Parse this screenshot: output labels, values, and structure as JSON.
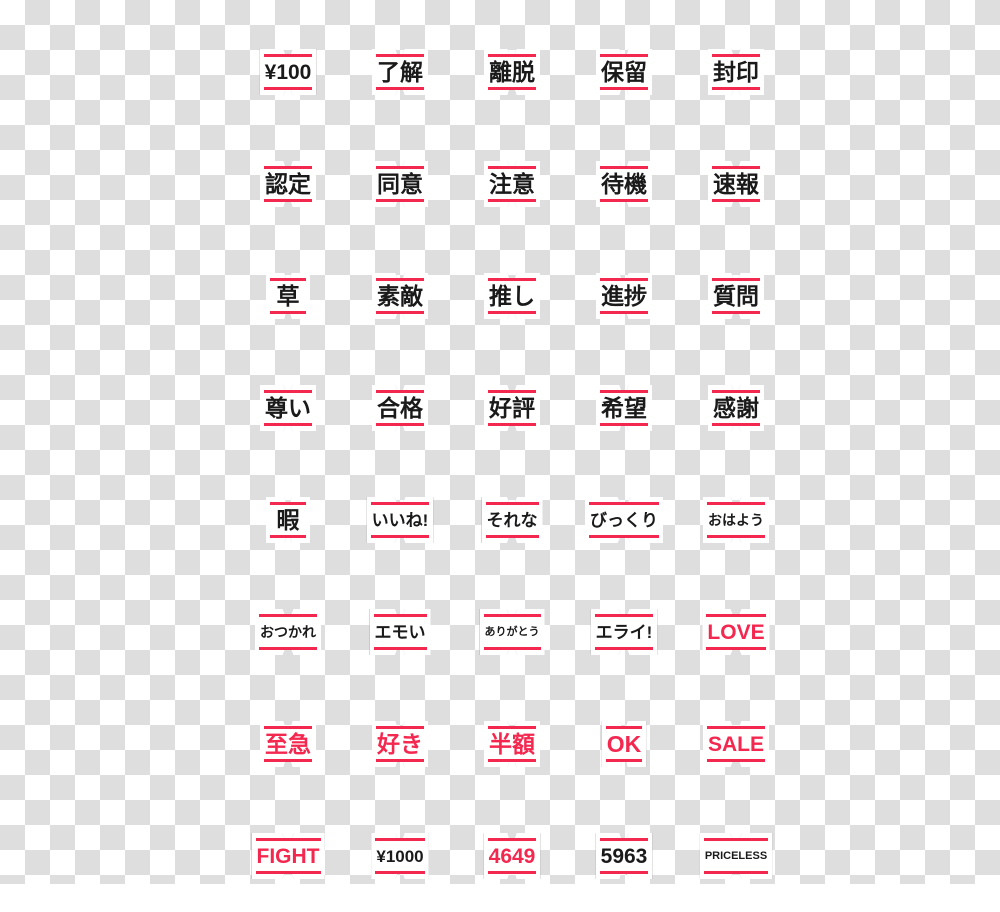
{
  "sheet": {
    "title": "Price Tag Sticker Sheet",
    "background": "transparent-checkerboard",
    "colors": {
      "accent_red": "#f4274f",
      "text_black": "#1a1a1a",
      "sticker_face": "#ffffff",
      "sticker_border": "#b4b4b4",
      "checker_gray": "#dedede",
      "checker_white": "#ffffff"
    },
    "grid": {
      "columns": 5,
      "rows": 8,
      "total": 40
    }
  },
  "stickers": [
    {
      "text": "¥100",
      "color": "black",
      "size": "lg",
      "script": "latin"
    },
    {
      "text": "了解",
      "color": "black",
      "size": "xl",
      "script": "cjk"
    },
    {
      "text": "離脱",
      "color": "black",
      "size": "xl",
      "script": "cjk"
    },
    {
      "text": "保留",
      "color": "black",
      "size": "xl",
      "script": "cjk"
    },
    {
      "text": "封印",
      "color": "black",
      "size": "xl",
      "script": "cjk"
    },
    {
      "text": "認定",
      "color": "black",
      "size": "xl",
      "script": "cjk"
    },
    {
      "text": "同意",
      "color": "black",
      "size": "xl",
      "script": "cjk"
    },
    {
      "text": "注意",
      "color": "black",
      "size": "xl",
      "script": "cjk"
    },
    {
      "text": "待機",
      "color": "black",
      "size": "xl",
      "script": "cjk"
    },
    {
      "text": "速報",
      "color": "black",
      "size": "xl",
      "script": "cjk"
    },
    {
      "text": "草",
      "color": "black",
      "size": "xl",
      "script": "cjk"
    },
    {
      "text": "素敵",
      "color": "black",
      "size": "xl",
      "script": "cjk"
    },
    {
      "text": "推し",
      "color": "black",
      "size": "xl",
      "script": "cjk"
    },
    {
      "text": "進捗",
      "color": "black",
      "size": "xl",
      "script": "cjk"
    },
    {
      "text": "質問",
      "color": "black",
      "size": "xl",
      "script": "cjk"
    },
    {
      "text": "尊い",
      "color": "black",
      "size": "xl",
      "script": "cjk"
    },
    {
      "text": "合格",
      "color": "black",
      "size": "xl",
      "script": "cjk"
    },
    {
      "text": "好評",
      "color": "black",
      "size": "xl",
      "script": "cjk"
    },
    {
      "text": "希望",
      "color": "black",
      "size": "xl",
      "script": "cjk"
    },
    {
      "text": "感謝",
      "color": "black",
      "size": "xl",
      "script": "cjk"
    },
    {
      "text": "暇",
      "color": "black",
      "size": "xl",
      "script": "cjk"
    },
    {
      "text": "いいね!",
      "color": "black",
      "size": "md",
      "script": "cjk"
    },
    {
      "text": "それな",
      "color": "black",
      "size": "md",
      "script": "cjk"
    },
    {
      "text": "びっくり",
      "color": "black",
      "size": "md",
      "script": "cjk"
    },
    {
      "text": "おはよう",
      "color": "black",
      "size": "sm",
      "script": "cjk"
    },
    {
      "text": "おつかれ",
      "color": "black",
      "size": "sm",
      "script": "cjk"
    },
    {
      "text": "エモい",
      "color": "black",
      "size": "md",
      "script": "cjk"
    },
    {
      "text": "ありがとう",
      "color": "black",
      "size": "xs",
      "script": "cjk"
    },
    {
      "text": "エライ!",
      "color": "black",
      "size": "md",
      "script": "cjk"
    },
    {
      "text": "LOVE",
      "color": "red",
      "size": "lg",
      "script": "latin"
    },
    {
      "text": "至急",
      "color": "red",
      "size": "xl",
      "script": "cjk"
    },
    {
      "text": "好き",
      "color": "red",
      "size": "xl",
      "script": "cjk"
    },
    {
      "text": "半額",
      "color": "red",
      "size": "xl",
      "script": "cjk"
    },
    {
      "text": "OK",
      "color": "red",
      "size": "xl",
      "script": "latin"
    },
    {
      "text": "SALE",
      "color": "red",
      "size": "lg",
      "script": "latin"
    },
    {
      "text": "FIGHT",
      "color": "red",
      "size": "lg",
      "script": "latin"
    },
    {
      "text": "¥1000",
      "color": "black",
      "size": "md",
      "script": "latin"
    },
    {
      "text": "4649",
      "color": "red",
      "size": "lg",
      "script": "latin"
    },
    {
      "text": "5963",
      "color": "black",
      "size": "lg",
      "script": "latin"
    },
    {
      "text": "PRICELESS",
      "color": "black",
      "size": "xs",
      "script": "latin"
    }
  ]
}
